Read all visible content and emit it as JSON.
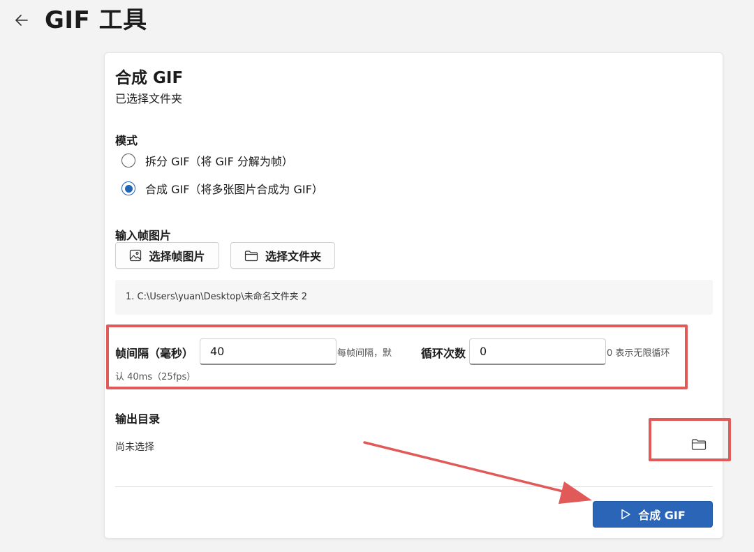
{
  "header": {
    "title": "GIF 工具"
  },
  "card": {
    "title": "合成 GIF",
    "subtitle": "已选择文件夹"
  },
  "mode": {
    "label": "模式",
    "options": [
      {
        "label": "拆分 GIF（将 GIF 分解为帧）",
        "checked": false
      },
      {
        "label": "合成 GIF（将多张图片合成为 GIF）",
        "checked": true
      }
    ]
  },
  "input_frames": {
    "label": "输入帧图片",
    "select_images_label": "选择帧图片",
    "select_folder_label": "选择文件夹",
    "paths": [
      "1. C:\\Users\\yuan\\Desktop\\未命名文件夹 2"
    ]
  },
  "settings": {
    "interval_label": "帧间隔（毫秒）",
    "interval_value": "40",
    "interval_hint_1": "每帧间隔，默",
    "interval_hint_2": "认 40ms（25fps）",
    "loop_label": "循环次数",
    "loop_value": "0",
    "loop_hint": "0 表示无限循环"
  },
  "output": {
    "label": "输出目录",
    "value": "尚未选择"
  },
  "actions": {
    "compose_label": "合成 GIF"
  },
  "colors": {
    "accent": "#2a65b7",
    "annotation": "#e05a5a"
  }
}
